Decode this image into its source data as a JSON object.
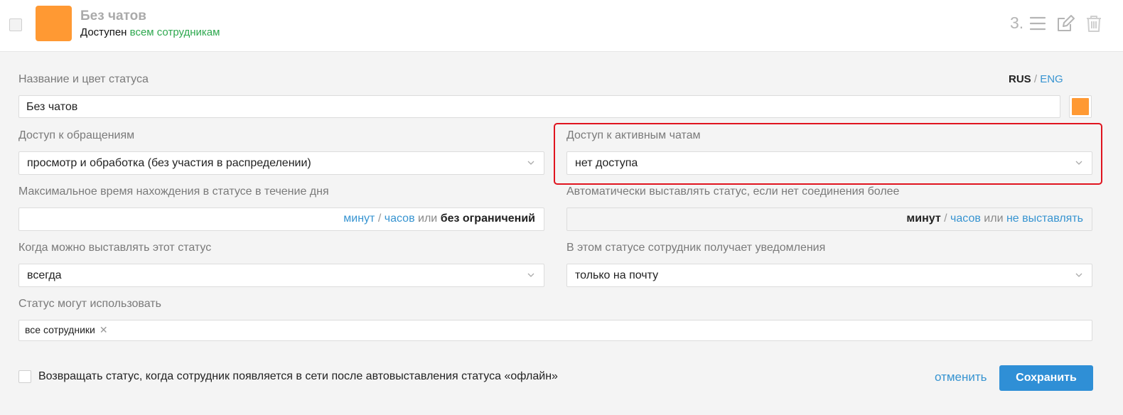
{
  "header": {
    "title": "Без чатов",
    "subtitle_prefix": "Доступен",
    "subtitle_link": "всем сотрудникам",
    "number": "3.",
    "swatch_color": "#ff9933",
    "icons": [
      "menu-icon",
      "edit-icon",
      "trash-icon"
    ]
  },
  "form": {
    "name_label": "Название и цвет статуса",
    "lang_rus": "RUS",
    "lang_sep": "/",
    "lang_eng": "ENG",
    "name_value": "Без чатов",
    "name_color": "#ff9933",
    "tickets_access_label": "Доступ к обращениям",
    "tickets_access_value": "просмотр и обработка (без участия в распределении)",
    "chats_access_label": "Доступ к активным чатам",
    "chats_access_value": "нет доступа",
    "max_time_label": "Максимальное время нахождения в статусе в течение дня",
    "max_time": {
      "minutes": "минут",
      "slash": "/",
      "hours": "часов",
      "or": "или",
      "unlimited": "без ограничений"
    },
    "auto_label": "Автоматически выставлять статус, если нет соединения более",
    "auto": {
      "minutes": "минут",
      "slash": "/",
      "hours": "часов",
      "or": "или",
      "not_set": "не выставлять"
    },
    "when_label": "Когда можно выставлять этот статус",
    "when_value": "всегда",
    "notify_label": "В этом статусе сотрудник получает уведомления",
    "notify_value": "только на почту",
    "users_label": "Статус могут использовать",
    "users_tag": "все сотрудники",
    "users_tag_remove": "✕",
    "return_status_text": "Возвращать статус, когда сотрудник появляется в сети после автовыставления статуса «офлайн»",
    "cancel_label": "отменить",
    "save_label": "Сохранить"
  },
  "colors": {
    "accent": "#2f8fd6",
    "link": "#3794d1",
    "green": "#2ea84f",
    "highlight": "#e0141f"
  }
}
